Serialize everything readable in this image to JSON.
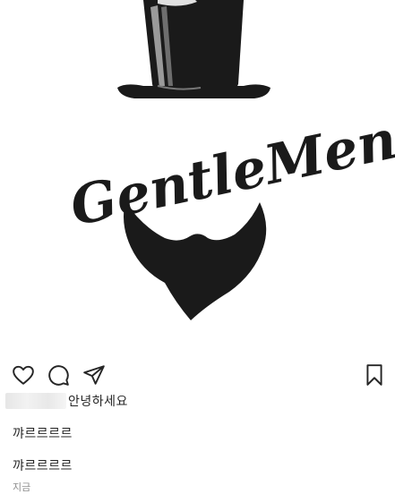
{
  "post": {
    "logo_text": "GentleMen",
    "image_description_icon": "gentleman-logo-illustration"
  },
  "actions": {
    "like_icon": "heart-outline-icon",
    "comment_icon": "comment-bubble-icon",
    "share_icon": "paper-plane-icon",
    "save_icon": "bookmark-outline-icon"
  },
  "caption": {
    "username": "",
    "text": "안녕하세요"
  },
  "comments": [
    {
      "text": "꺄르르르르"
    },
    {
      "text": "꺄르르르르"
    }
  ],
  "timestamp": "지금",
  "colors": {
    "logo_fill": "#1a1a1a",
    "text": "#262626",
    "muted": "#8e8e8e"
  }
}
